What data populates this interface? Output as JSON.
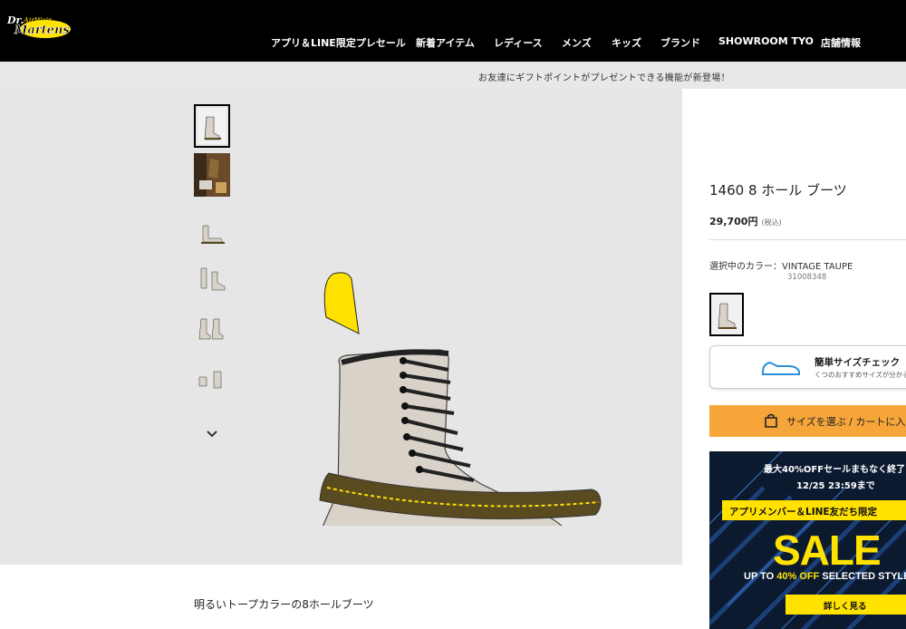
{
  "header": {
    "logo_text": "Dr. Martens AirWair",
    "nav": [
      "アプリ＆LINE限定プレセール",
      "新着アイテム",
      "レディース",
      "メンズ",
      "キッズ",
      "ブランド",
      "SHOWROOM TYO",
      "店舗情報"
    ]
  },
  "announcement": "お友達にギフトポイントがプレゼントできる機能が新登場！",
  "product": {
    "title": "1460 8 ホール ブーツ",
    "price": "29,700円",
    "tax_note": "(税込)",
    "color_label": "選択中のカラー：VINTAGE TAUPE",
    "sku": "31008348",
    "description_heading": "明るいトープカラーの8ホールブーツ"
  },
  "size_check": {
    "title": "簡単サイズチェック",
    "subtitle": "くつのおすすめサイズが分かる"
  },
  "cta": {
    "select_size": "サイズを選ぶ / カートに入れる"
  },
  "banner": {
    "line1": "最大40%OFFセールまもなく終了",
    "line2": "12/25 23:59まで",
    "strip": "アプリメンバー＆LINE友だち限定",
    "sale": "SALE",
    "upto_prefix": "UP TO ",
    "upto_highlight": "40% OFF",
    "upto_suffix": " SELECTED STYLES",
    "button": "詳しく見る"
  },
  "colors": {
    "header_bg": "#000000",
    "accent_yellow": "#ffe200",
    "cta_orange": "#f5a53a",
    "gallery_bg": "#e6e6e6",
    "boot_taupe": "#d8d2c8"
  },
  "icons": [
    "chevron-down-icon",
    "shoe-icon",
    "shopping-bag-icon"
  ]
}
